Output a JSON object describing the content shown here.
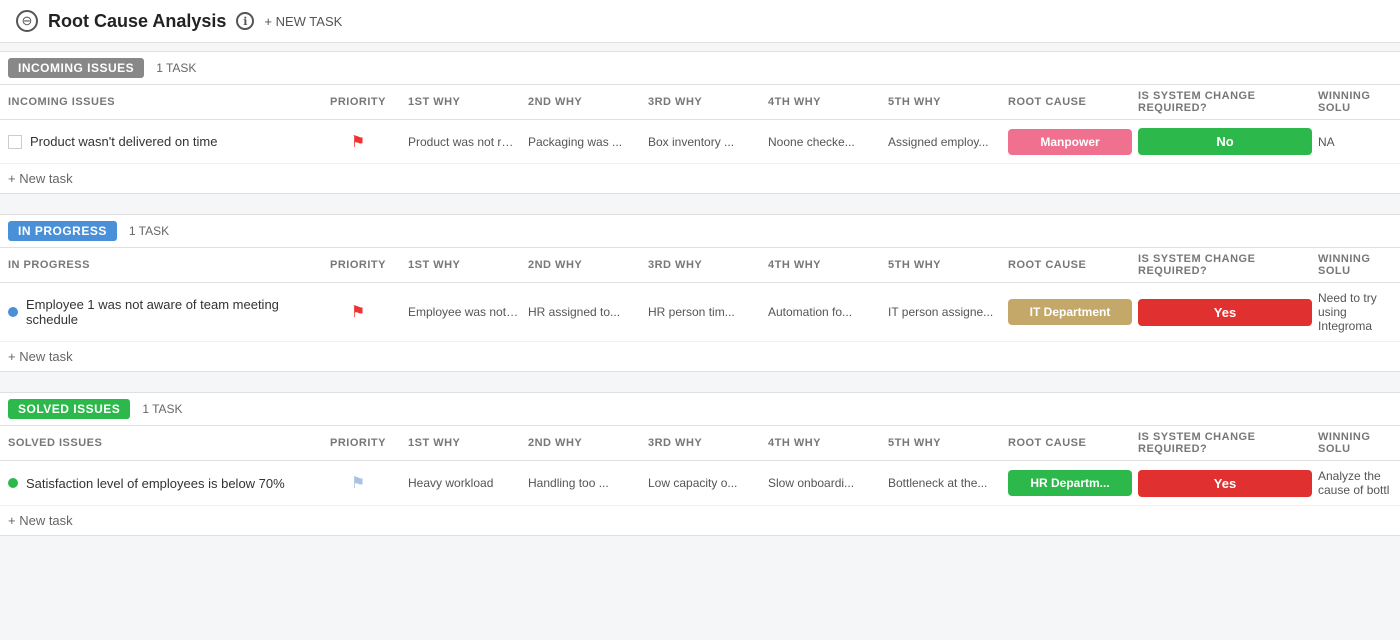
{
  "header": {
    "title": "Root Cause Analysis",
    "info_icon": "ℹ",
    "circle_icon": "⊖",
    "new_task_label": "+ NEW TASK"
  },
  "sections": [
    {
      "id": "incoming",
      "badge_label": "INCOMING ISSUES",
      "badge_class": "badge-incoming",
      "task_count": "1 TASK",
      "columns": [
        "INCOMING ISSUES",
        "PRIORITY",
        "1ST WHY",
        "2ND WHY",
        "3RD WHY",
        "4TH WHY",
        "5TH WHY",
        "ROOT CAUSE",
        "IS SYSTEM CHANGE REQUIRED?",
        "WINNING SOLU"
      ],
      "rows": [
        {
          "indicator": "checkbox",
          "issue": "Product wasn't delivered on time",
          "priority": "red",
          "why1": "Product was not rea...",
          "why2": "Packaging was ...",
          "why3": "Box inventory ...",
          "why4": "Noone checke...",
          "why5": "Assigned employ...",
          "root_cause": "Manpower",
          "root_class": "root-pink",
          "sys_change": "No",
          "sys_class": "syschange-green",
          "winning": "NA"
        }
      ],
      "add_task_label": "+ New task"
    },
    {
      "id": "inprogress",
      "badge_label": "IN PROGRESS",
      "badge_class": "badge-inprogress",
      "task_count": "1 TASK",
      "columns": [
        "IN PROGRESS",
        "PRIORITY",
        "1ST WHY",
        "2ND WHY",
        "3RD WHY",
        "4TH WHY",
        "5TH WHY",
        "ROOT CAUSE",
        "IS SYSTEM CHANGE REQUIRED?",
        "WINNING SOLU"
      ],
      "rows": [
        {
          "indicator": "dot-blue",
          "issue": "Employee 1 was not aware of team meeting schedule",
          "priority": "red",
          "why1": "Employee was not b...",
          "why2": "HR assigned to...",
          "why3": "HR person tim...",
          "why4": "Automation fo...",
          "why5": "IT person assigne...",
          "root_cause": "IT Department",
          "root_class": "root-tan",
          "sys_change": "Yes",
          "sys_class": "syschange-red",
          "winning": "Need to try using Integroma"
        }
      ],
      "add_task_label": "+ New task"
    },
    {
      "id": "solved",
      "badge_label": "SOLVED ISSUES",
      "badge_class": "badge-solved",
      "task_count": "1 TASK",
      "columns": [
        "SOLVED ISSUES",
        "PRIORITY",
        "1ST WHY",
        "2ND WHY",
        "3RD WHY",
        "4TH WHY",
        "5TH WHY",
        "ROOT CAUSE",
        "IS SYSTEM CHANGE REQUIRED?",
        "WINNING SOLU"
      ],
      "rows": [
        {
          "indicator": "dot-green",
          "issue": "Satisfaction level of employees is below 70%",
          "priority": "light",
          "why1": "Heavy workload",
          "why2": "Handling too ...",
          "why3": "Low capacity o...",
          "why4": "Slow onboardi...",
          "why5": "Bottleneck at the...",
          "root_cause": "HR Departm...",
          "root_class": "root-hr",
          "sys_change": "Yes",
          "sys_class": "syschange-red",
          "winning": "Analyze the cause of bottl"
        }
      ],
      "add_task_label": "+ New task"
    }
  ]
}
